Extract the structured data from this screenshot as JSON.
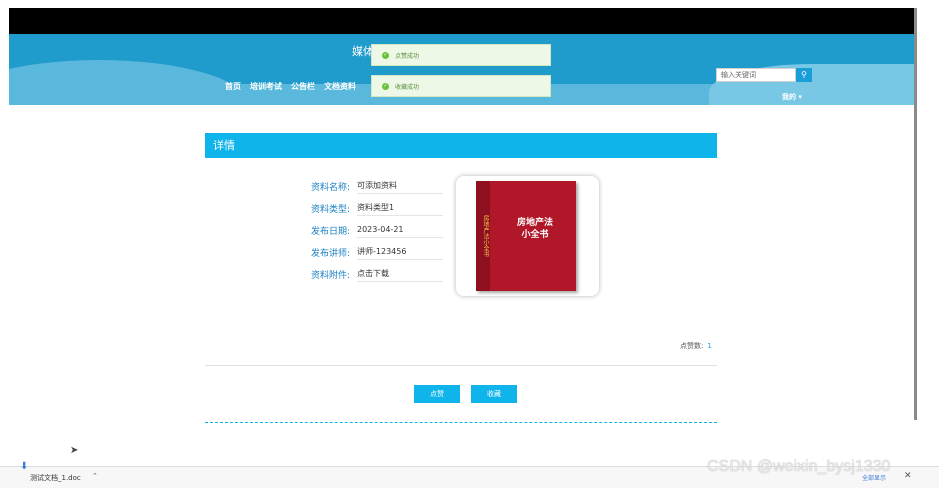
{
  "site": {
    "title": "媒体",
    "search_placeholder": "输入关键词",
    "user_menu": "我的 ▾"
  },
  "nav": [
    "首页",
    "培训考试",
    "公告栏",
    "文档资料"
  ],
  "toasts": [
    "点赞成功",
    "收藏成功"
  ],
  "panel": {
    "title": "详情"
  },
  "fields": [
    {
      "label": "资料名称:",
      "value": "可添加资料"
    },
    {
      "label": "资料类型:",
      "value": "资料类型1"
    },
    {
      "label": "发布日期:",
      "value": "2023-04-21"
    },
    {
      "label": "发布讲师:",
      "value": "讲师-123456"
    },
    {
      "label": "资料附件:",
      "value": "点击下载"
    }
  ],
  "book": {
    "spine": "房地产法小全书",
    "title": "房地产法",
    "subtitle": "小全书"
  },
  "likes": {
    "label": "点赞数:",
    "count": "1"
  },
  "buttons": {
    "like": "点赞",
    "favorite": "收藏"
  },
  "download": {
    "file": "测试文档_1.doc",
    "show_all": "全部显示"
  },
  "watermark": "CSDN @weixin_bysj1330",
  "colors": {
    "accent": "#0eb4ea",
    "header": "#1f9ccb",
    "success": "#67c23a"
  }
}
